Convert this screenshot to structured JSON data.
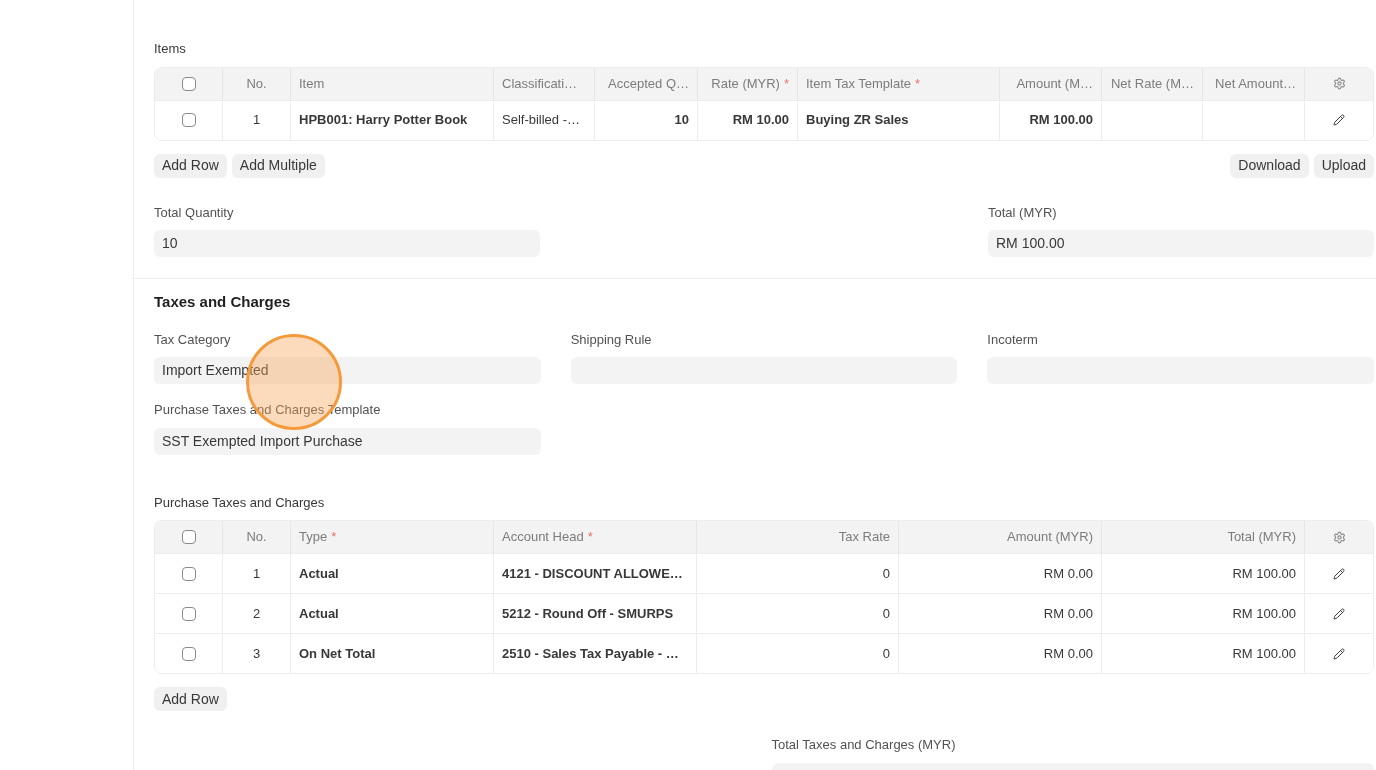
{
  "items_section": {
    "title": "Items",
    "table": {
      "header_checked": false,
      "columns": [
        {
          "label": "No.",
          "kind": "index"
        },
        {
          "label": "Item",
          "kind": "text",
          "bold": true
        },
        {
          "label": "Classificati…",
          "kind": "text"
        },
        {
          "label": "Accepted Q…",
          "kind": "number",
          "bold": true
        },
        {
          "label": "Rate (MYR)",
          "required_mark": "*",
          "kind": "number",
          "bold": true
        },
        {
          "label": "Item Tax Template",
          "required_mark": "*",
          "kind": "text",
          "bold": true
        },
        {
          "label": "Amount (M…",
          "kind": "number",
          "bold": true
        },
        {
          "label": "Net Rate (M…",
          "kind": "number"
        },
        {
          "label": "Net Amount…",
          "kind": "number"
        }
      ],
      "rows": [
        {
          "checked": false,
          "cells": [
            "1",
            "HPB001: Harry Potter Book",
            "Self-billed -…",
            "10",
            "RM 10.00",
            "Buying ZR Sales",
            "RM 100.00",
            null,
            null
          ]
        }
      ]
    },
    "buttons_left": [
      "Add Row",
      "Add Multiple"
    ],
    "buttons_right": [
      "Download",
      "Upload"
    ]
  },
  "totals": [
    {
      "label": "Total Quantity",
      "value": "10"
    },
    {
      "label": "Total (MYR)",
      "value": "RM 100.00"
    }
  ],
  "taxes_section": {
    "title": "Taxes and Charges",
    "fields": [
      {
        "label": "Tax Category",
        "value": "Import Exempted"
      },
      {
        "label": "Shipping Rule"
      },
      {
        "label": "Incoterm"
      },
      {
        "label": "Purchase Taxes and Charges Template",
        "value": "SST Exempted Import Purchase"
      }
    ],
    "table_title": "Purchase Taxes and Charges",
    "table": {
      "header_checked": false,
      "columns": [
        {
          "label": "No.",
          "kind": "index"
        },
        {
          "label": "Type",
          "required_mark": "*",
          "kind": "text",
          "bold": true
        },
        {
          "label": "Account Head",
          "required_mark": "*",
          "kind": "text",
          "bold": true
        },
        {
          "label": "Tax Rate",
          "kind": "number"
        },
        {
          "label": "Amount (MYR)",
          "kind": "number"
        },
        {
          "label": "Total (MYR)",
          "kind": "number"
        }
      ],
      "rows": [
        {
          "checked": false,
          "cells": [
            "1",
            "Actual",
            "4121 - DISCOUNT ALLOWE…",
            "0",
            "RM 0.00",
            "RM 100.00"
          ]
        },
        {
          "checked": false,
          "cells": [
            "2",
            "Actual",
            "5212 - Round Off - SMURPS",
            "0",
            "RM 0.00",
            "RM 100.00"
          ]
        },
        {
          "checked": false,
          "cells": [
            "3",
            "On Net Total",
            "2510 - Sales Tax Payable - …",
            "0",
            "RM 0.00",
            "RM 100.00"
          ]
        }
      ]
    },
    "buttons": [
      "Add Row"
    ],
    "total_field": {
      "label": "Total Taxes and Charges (MYR)"
    }
  }
}
